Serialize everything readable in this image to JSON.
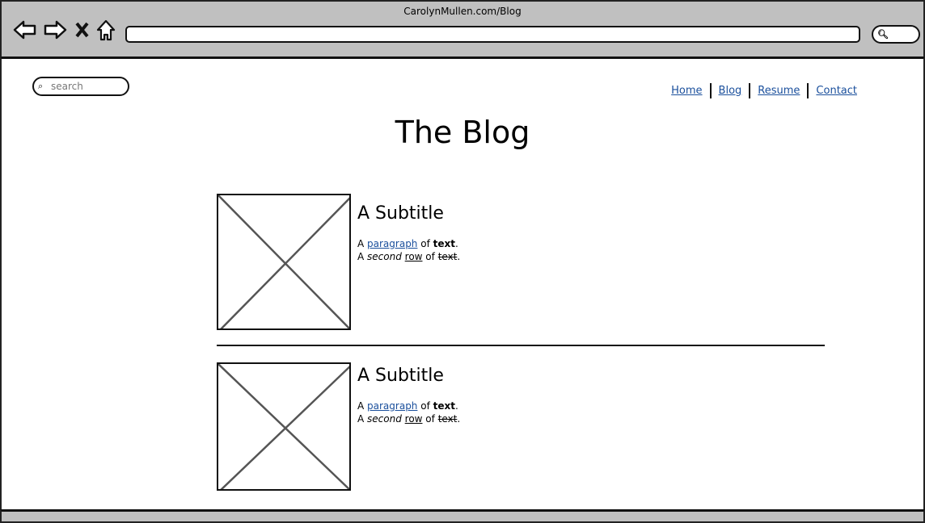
{
  "browser": {
    "title": "CarolynMullen.com/Blog",
    "url": ""
  },
  "search": {
    "placeholder": "search"
  },
  "nav": [
    {
      "label": "Home"
    },
    {
      "label": "Blog"
    },
    {
      "label": "Resume"
    },
    {
      "label": "Contact"
    }
  ],
  "page_title": "The Blog",
  "posts": [
    {
      "subtitle": "A Subtitle",
      "l1a": "A ",
      "l1link": "paragraph",
      "l1b": " of ",
      "l1bold": "text",
      "l1end": ".",
      "l2a": "A ",
      "l2it": "second",
      "l2sp": " ",
      "l2u": "row",
      "l2b": " of ",
      "l2strike": "text",
      "l2end": "."
    },
    {
      "subtitle": "A Subtitle",
      "l1a": "A ",
      "l1link": "paragraph",
      "l1b": " of ",
      "l1bold": "text",
      "l1end": ".",
      "l2a": "A ",
      "l2it": "second",
      "l2sp": " ",
      "l2u": "row",
      "l2b": " of ",
      "l2strike": "text",
      "l2end": "."
    }
  ]
}
